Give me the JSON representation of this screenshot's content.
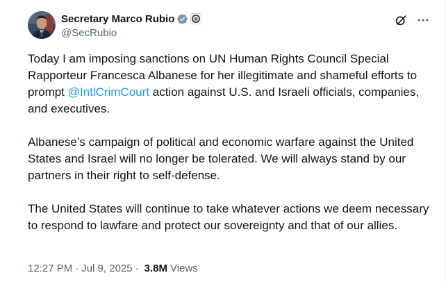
{
  "author": {
    "display_name": "Secretary Marco Rubio",
    "handle": "@SecRubio"
  },
  "icons": {
    "verified": "verified-badge-icon",
    "affiliation": "government-seal-icon",
    "grok": "grok-icon",
    "more": "more-options-icon"
  },
  "colors": {
    "link": "#1d9bf0",
    "secondary_text": "#536471",
    "primary_text": "#0f1419",
    "verified_badge": "#829aab"
  },
  "tweet": {
    "p1_a": "Today I am imposing sanctions on UN Human Rights Council Special Rapporteur Francesca Albanese for her illegitimate and shameful efforts to prompt ",
    "p1_mention": "@IntlCrimCourt",
    "p1_b": " action against U.S. and Israeli officials, companies, and executives.",
    "p2": "Albanese’s campaign of political and economic warfare against the United States and Israel will no longer be tolerated. We will always stand by our partners in their right to self-defense.",
    "p3": "The United States will continue to take whatever actions we deem necessary to respond to lawfare and protect our sovereignty and that of our allies."
  },
  "meta": {
    "time": "12:27 PM",
    "separator": "·",
    "date": "Jul 9, 2025",
    "views_count": "3.8M",
    "views_label": "Views"
  }
}
